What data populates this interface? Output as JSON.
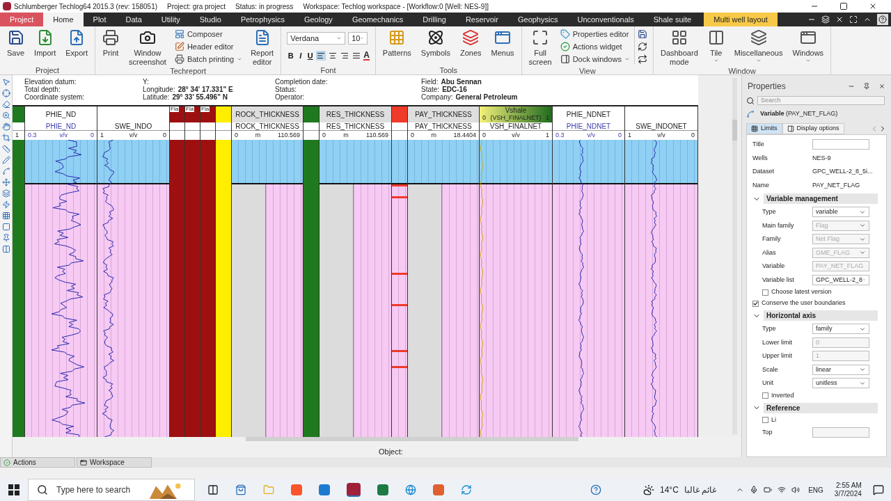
{
  "title_bar": {
    "title": "Schlumberger Techlog64 2015.3 (rev: 158051)",
    "project": "Project: gra project",
    "status": "Status: in progress",
    "workspace": "Workspace: Techlog workspace - [Workflow:0 [Well: NES-9]]"
  },
  "menu_tabs": [
    {
      "label": "Project",
      "kind": "file",
      "selected": false
    },
    {
      "label": "Home",
      "kind": "normal",
      "selected": true
    },
    {
      "label": "Plot",
      "kind": "normal",
      "selected": false
    },
    {
      "label": "Data",
      "kind": "normal",
      "selected": false
    },
    {
      "label": "Utility",
      "kind": "normal",
      "selected": false
    },
    {
      "label": "Studio",
      "kind": "normal",
      "selected": false
    },
    {
      "label": "Petrophysics",
      "kind": "normal",
      "selected": false
    },
    {
      "label": "Geology",
      "kind": "normal",
      "selected": false
    },
    {
      "label": "Geomechanics",
      "kind": "normal",
      "selected": false
    },
    {
      "label": "Drilling",
      "kind": "normal",
      "selected": false
    },
    {
      "label": "Reservoir",
      "kind": "normal",
      "selected": false
    },
    {
      "label": "Geophysics",
      "kind": "normal",
      "selected": false
    },
    {
      "label": "Unconventionals",
      "kind": "normal",
      "selected": false
    },
    {
      "label": "Shale suite",
      "kind": "normal",
      "selected": false
    },
    {
      "label": "Multi well layout",
      "kind": "contextual",
      "selected": false
    }
  ],
  "ribbon": [
    {
      "label": "Project",
      "items": [
        {
          "kind": "large",
          "label": "Save",
          "dropdown": false
        },
        {
          "kind": "large",
          "label": "Import",
          "dropdown": false
        },
        {
          "kind": "large",
          "label": "Export",
          "dropdown": false
        }
      ]
    },
    {
      "label": "Techreport",
      "items": [
        {
          "kind": "large",
          "label": "Print",
          "dropdown": false
        },
        {
          "kind": "large",
          "label": "Window screenshot",
          "dropdown": false
        },
        {
          "kind": "small",
          "label": "Composer",
          "dropdown": false
        },
        {
          "kind": "small",
          "label": "Header editor",
          "dropdown": false
        },
        {
          "kind": "small",
          "label": "Batch printing",
          "dropdown": true
        },
        {
          "kind": "large",
          "label": "Report editor",
          "dropdown": false
        }
      ]
    },
    {
      "label": "Font",
      "kind": "font",
      "font": {
        "name": "Verdana",
        "size": "10",
        "styles": [
          "B",
          "I",
          "U"
        ],
        "alignments": [
          {
            "selected": true
          },
          {
            "selected": false
          },
          {
            "selected": false
          },
          {
            "selected": false
          }
        ],
        "color_button": "A"
      }
    },
    {
      "label": "Tools",
      "items": [
        {
          "kind": "large",
          "label": "Patterns",
          "dropdown": false
        },
        {
          "kind": "large",
          "label": "Symbols",
          "dropdown": false
        },
        {
          "kind": "large",
          "label": "Zones",
          "dropdown": false
        },
        {
          "kind": "large",
          "label": "Menus",
          "dropdown": false
        }
      ]
    },
    {
      "label": "View",
      "items": [
        {
          "kind": "large",
          "label": "Full screen",
          "dropdown": false
        },
        {
          "kind": "small",
          "label": "Properties editor",
          "dropdown": false
        },
        {
          "kind": "small",
          "label": "Actions widget",
          "dropdown": false
        },
        {
          "kind": "small",
          "label": "Dock windows",
          "dropdown": true
        },
        {
          "kind": "icons"
        }
      ]
    },
    {
      "label": "Window",
      "items": [
        {
          "kind": "large",
          "label": "Dashboard mode",
          "dropdown": false
        },
        {
          "kind": "large",
          "label": "Tile",
          "dropdown": true
        },
        {
          "kind": "large",
          "label": "Miscellaneous",
          "dropdown": true
        },
        {
          "kind": "large",
          "label": "Windows",
          "dropdown": true
        }
      ]
    }
  ],
  "well_header": [
    [
      {
        "label": "Elevation datum:"
      },
      {
        "label": "Total depth:"
      },
      {
        "label": "Coordinate system:"
      }
    ],
    [
      {
        "label": "Y:"
      },
      {
        "label": "Longitude:",
        "value": "28° 34' 17.331\" E"
      },
      {
        "label": "Latitude:",
        "value": "29° 33' 55.496\" N"
      }
    ],
    [
      {
        "label": "Completion date:"
      },
      {
        "label": "Status:"
      },
      {
        "label": "Operator:"
      }
    ],
    [
      {
        "label": "Field:",
        "value": "Abu Sennan"
      },
      {
        "label": "State:",
        "value": "EDC-16"
      },
      {
        "label": "Company:",
        "value": "General Petroleum"
      }
    ]
  ],
  "tracks": [
    {
      "kind": "flag",
      "color": "#1f7a1f",
      "scale": [
        "1"
      ]
    },
    {
      "kind": "curve",
      "title": "PHIE_ND",
      "curve": "PHIE_ND",
      "scale": [
        "0.3",
        "v/v",
        "0"
      ]
    },
    {
      "kind": "curve",
      "curve": "SWE_INDO",
      "scale": [
        "1",
        "v/v",
        "0"
      ]
    },
    {
      "kind": "flag",
      "color": "#9e1010",
      "title": "Fla"
    },
    {
      "kind": "flag",
      "color": "#9e1010",
      "title": "Fla"
    },
    {
      "kind": "flag",
      "color": "#9e1010",
      "title": "Fla"
    },
    {
      "kind": "flag",
      "color": "#ffee00"
    },
    {
      "kind": "thickness",
      "title": "ROCK_THICKNESS",
      "curve": "ROCK_THICKNESS",
      "scale": [
        "0",
        "m",
        "110.569"
      ]
    },
    {
      "kind": "flag",
      "color": "#1f7a1f"
    },
    {
      "kind": "thickness",
      "title": "RES_THICKNESS",
      "curve": "RES_THICKNESS",
      "scale": [
        "0",
        "m",
        "110.569"
      ]
    },
    {
      "kind": "marks",
      "color": "#f03a2a"
    },
    {
      "kind": "thickness",
      "title": "PAY_THICKNESS",
      "curve": "PAY_THICKNESS",
      "scale": [
        "0",
        "m",
        "18.4404"
      ]
    },
    {
      "kind": "shale",
      "title": "Vshale",
      "legend": [
        "0",
        "(VSH_FINALNET)",
        "1"
      ],
      "curve": "VSH_FINALNET",
      "scale": [
        "0",
        "v/v",
        "1"
      ]
    },
    {
      "kind": "curve",
      "title": "PHIE_NDNET",
      "curve": "PHIE_NDNET",
      "scale": [
        "0.3",
        "v/v",
        "0"
      ]
    },
    {
      "kind": "curve",
      "curve": "SWE_INDONET",
      "scale": [
        "1",
        "v/v",
        "0"
      ]
    }
  ],
  "object_label": "Object:",
  "properties": {
    "title": "Properties",
    "search_placeholder": "Search",
    "variable": "**Variable** (PAY_NET_FLAG)",
    "tabs": [
      {
        "label": "Limits",
        "selected": true
      },
      {
        "label": "Display options",
        "selected": false
      }
    ],
    "rows": [
      {
        "kind": "input",
        "label": "Title"
      },
      {
        "kind": "text",
        "label": "Wells",
        "value": "NES-9"
      },
      {
        "kind": "text",
        "label": "Dataset",
        "value": "GPC_WELL-2_8_5i..."
      },
      {
        "kind": "text",
        "label": "Name",
        "value": "PAY_NET_FLAG"
      },
      {
        "kind": "section",
        "label": "Variable management",
        "expanded": true,
        "children": [
          {
            "kind": "select",
            "label": "Type",
            "value": "variable",
            "disabled": false
          },
          {
            "kind": "select",
            "label": "Main family",
            "value": "Flag",
            "disabled": true
          },
          {
            "kind": "select",
            "label": "Family",
            "value": "Net Flag",
            "disabled": true
          },
          {
            "kind": "select",
            "label": "Alias",
            "value": "GME_FLAG",
            "disabled": true
          },
          {
            "kind": "input",
            "label": "Variable",
            "value": "PAY_NET_FLAG",
            "disabled": true
          },
          {
            "kind": "select",
            "label": "Variable list",
            "value": "GPC_WELL-2_8",
            "disabled": false
          },
          {
            "kind": "checkbox",
            "label": "Choose latest version",
            "checked": false
          }
        ]
      },
      {
        "kind": "checkbox",
        "label": "Conserve the user boundaries",
        "checked": true
      },
      {
        "kind": "section",
        "label": "Horizontal axis",
        "expanded": true,
        "children": [
          {
            "kind": "select",
            "label": "Type",
            "value": "family",
            "disabled": false
          },
          {
            "kind": "input",
            "label": "Lower limit",
            "value": "0",
            "disabled": true
          },
          {
            "kind": "input",
            "label": "Upper limit",
            "value": "1",
            "disabled": true
          },
          {
            "kind": "select",
            "label": "Scale",
            "value": "linear",
            "disabled": false
          },
          {
            "kind": "select",
            "label": "Unit",
            "value": "unitless",
            "disabled": false
          },
          {
            "kind": "checkbox",
            "label": "Inverted",
            "checked": false
          }
        ]
      },
      {
        "kind": "section",
        "label": "Reference",
        "expanded": true,
        "children": [
          {
            "kind": "checkbox",
            "label": "Li",
            "checked": false
          },
          {
            "kind": "input",
            "label": "Top",
            "disabled": true
          }
        ]
      }
    ]
  },
  "dock_tabs": [
    {
      "label": "Actions"
    },
    {
      "label": "Workspace"
    }
  ],
  "taskbar": {
    "search_placeholder": "Type here to search",
    "temperature": "14°C",
    "weather": "غائم غالبا",
    "language": "ENG",
    "time": "2:55 AM",
    "date": "3/7/2024"
  }
}
